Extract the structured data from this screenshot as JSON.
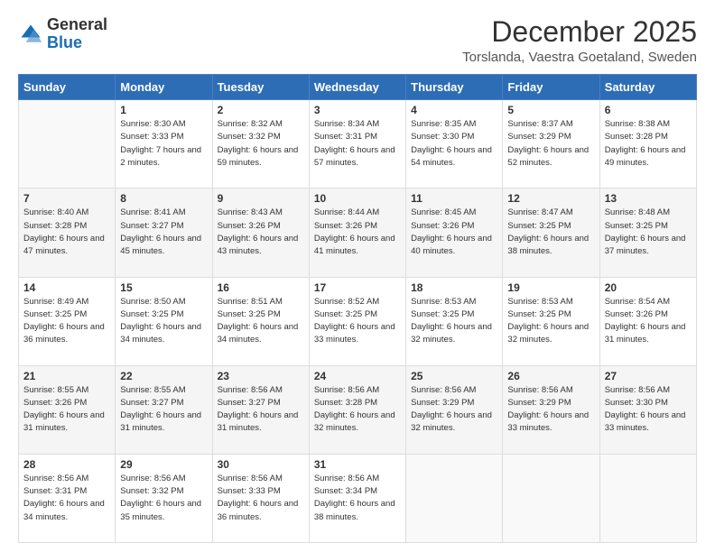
{
  "logo": {
    "general": "General",
    "blue": "Blue"
  },
  "header": {
    "month_title": "December 2025",
    "location": "Torslanda, Vaestra Goetaland, Sweden"
  },
  "days_of_week": [
    "Sunday",
    "Monday",
    "Tuesday",
    "Wednesday",
    "Thursday",
    "Friday",
    "Saturday"
  ],
  "weeks": [
    [
      {
        "day": "",
        "sunrise": "",
        "sunset": "",
        "daylight": ""
      },
      {
        "day": "1",
        "sunrise": "Sunrise: 8:30 AM",
        "sunset": "Sunset: 3:33 PM",
        "daylight": "Daylight: 7 hours and 2 minutes."
      },
      {
        "day": "2",
        "sunrise": "Sunrise: 8:32 AM",
        "sunset": "Sunset: 3:32 PM",
        "daylight": "Daylight: 6 hours and 59 minutes."
      },
      {
        "day": "3",
        "sunrise": "Sunrise: 8:34 AM",
        "sunset": "Sunset: 3:31 PM",
        "daylight": "Daylight: 6 hours and 57 minutes."
      },
      {
        "day": "4",
        "sunrise": "Sunrise: 8:35 AM",
        "sunset": "Sunset: 3:30 PM",
        "daylight": "Daylight: 6 hours and 54 minutes."
      },
      {
        "day": "5",
        "sunrise": "Sunrise: 8:37 AM",
        "sunset": "Sunset: 3:29 PM",
        "daylight": "Daylight: 6 hours and 52 minutes."
      },
      {
        "day": "6",
        "sunrise": "Sunrise: 8:38 AM",
        "sunset": "Sunset: 3:28 PM",
        "daylight": "Daylight: 6 hours and 49 minutes."
      }
    ],
    [
      {
        "day": "7",
        "sunrise": "Sunrise: 8:40 AM",
        "sunset": "Sunset: 3:28 PM",
        "daylight": "Daylight: 6 hours and 47 minutes."
      },
      {
        "day": "8",
        "sunrise": "Sunrise: 8:41 AM",
        "sunset": "Sunset: 3:27 PM",
        "daylight": "Daylight: 6 hours and 45 minutes."
      },
      {
        "day": "9",
        "sunrise": "Sunrise: 8:43 AM",
        "sunset": "Sunset: 3:26 PM",
        "daylight": "Daylight: 6 hours and 43 minutes."
      },
      {
        "day": "10",
        "sunrise": "Sunrise: 8:44 AM",
        "sunset": "Sunset: 3:26 PM",
        "daylight": "Daylight: 6 hours and 41 minutes."
      },
      {
        "day": "11",
        "sunrise": "Sunrise: 8:45 AM",
        "sunset": "Sunset: 3:26 PM",
        "daylight": "Daylight: 6 hours and 40 minutes."
      },
      {
        "day": "12",
        "sunrise": "Sunrise: 8:47 AM",
        "sunset": "Sunset: 3:25 PM",
        "daylight": "Daylight: 6 hours and 38 minutes."
      },
      {
        "day": "13",
        "sunrise": "Sunrise: 8:48 AM",
        "sunset": "Sunset: 3:25 PM",
        "daylight": "Daylight: 6 hours and 37 minutes."
      }
    ],
    [
      {
        "day": "14",
        "sunrise": "Sunrise: 8:49 AM",
        "sunset": "Sunset: 3:25 PM",
        "daylight": "Daylight: 6 hours and 36 minutes."
      },
      {
        "day": "15",
        "sunrise": "Sunrise: 8:50 AM",
        "sunset": "Sunset: 3:25 PM",
        "daylight": "Daylight: 6 hours and 34 minutes."
      },
      {
        "day": "16",
        "sunrise": "Sunrise: 8:51 AM",
        "sunset": "Sunset: 3:25 PM",
        "daylight": "Daylight: 6 hours and 34 minutes."
      },
      {
        "day": "17",
        "sunrise": "Sunrise: 8:52 AM",
        "sunset": "Sunset: 3:25 PM",
        "daylight": "Daylight: 6 hours and 33 minutes."
      },
      {
        "day": "18",
        "sunrise": "Sunrise: 8:53 AM",
        "sunset": "Sunset: 3:25 PM",
        "daylight": "Daylight: 6 hours and 32 minutes."
      },
      {
        "day": "19",
        "sunrise": "Sunrise: 8:53 AM",
        "sunset": "Sunset: 3:25 PM",
        "daylight": "Daylight: 6 hours and 32 minutes."
      },
      {
        "day": "20",
        "sunrise": "Sunrise: 8:54 AM",
        "sunset": "Sunset: 3:26 PM",
        "daylight": "Daylight: 6 hours and 31 minutes."
      }
    ],
    [
      {
        "day": "21",
        "sunrise": "Sunrise: 8:55 AM",
        "sunset": "Sunset: 3:26 PM",
        "daylight": "Daylight: 6 hours and 31 minutes."
      },
      {
        "day": "22",
        "sunrise": "Sunrise: 8:55 AM",
        "sunset": "Sunset: 3:27 PM",
        "daylight": "Daylight: 6 hours and 31 minutes."
      },
      {
        "day": "23",
        "sunrise": "Sunrise: 8:56 AM",
        "sunset": "Sunset: 3:27 PM",
        "daylight": "Daylight: 6 hours and 31 minutes."
      },
      {
        "day": "24",
        "sunrise": "Sunrise: 8:56 AM",
        "sunset": "Sunset: 3:28 PM",
        "daylight": "Daylight: 6 hours and 32 minutes."
      },
      {
        "day": "25",
        "sunrise": "Sunrise: 8:56 AM",
        "sunset": "Sunset: 3:29 PM",
        "daylight": "Daylight: 6 hours and 32 minutes."
      },
      {
        "day": "26",
        "sunrise": "Sunrise: 8:56 AM",
        "sunset": "Sunset: 3:29 PM",
        "daylight": "Daylight: 6 hours and 33 minutes."
      },
      {
        "day": "27",
        "sunrise": "Sunrise: 8:56 AM",
        "sunset": "Sunset: 3:30 PM",
        "daylight": "Daylight: 6 hours and 33 minutes."
      }
    ],
    [
      {
        "day": "28",
        "sunrise": "Sunrise: 8:56 AM",
        "sunset": "Sunset: 3:31 PM",
        "daylight": "Daylight: 6 hours and 34 minutes."
      },
      {
        "day": "29",
        "sunrise": "Sunrise: 8:56 AM",
        "sunset": "Sunset: 3:32 PM",
        "daylight": "Daylight: 6 hours and 35 minutes."
      },
      {
        "day": "30",
        "sunrise": "Sunrise: 8:56 AM",
        "sunset": "Sunset: 3:33 PM",
        "daylight": "Daylight: 6 hours and 36 minutes."
      },
      {
        "day": "31",
        "sunrise": "Sunrise: 8:56 AM",
        "sunset": "Sunset: 3:34 PM",
        "daylight": "Daylight: 6 hours and 38 minutes."
      },
      {
        "day": "",
        "sunrise": "",
        "sunset": "",
        "daylight": ""
      },
      {
        "day": "",
        "sunrise": "",
        "sunset": "",
        "daylight": ""
      },
      {
        "day": "",
        "sunrise": "",
        "sunset": "",
        "daylight": ""
      }
    ]
  ]
}
